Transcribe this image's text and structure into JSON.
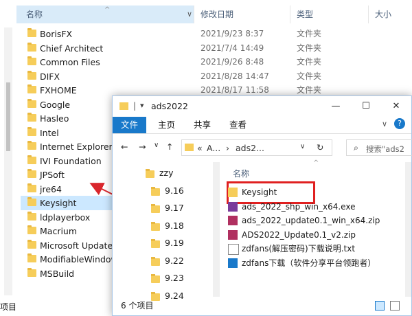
{
  "back": {
    "columns": {
      "name": "名称",
      "date": "修改日期",
      "type": "类型",
      "size": "大小"
    },
    "rows": [
      {
        "name": "BorisFX",
        "date": "2021/9/23 8:37",
        "type": "文件夹"
      },
      {
        "name": "Chief Architect",
        "date": "2021/7/4 14:49",
        "type": "文件夹"
      },
      {
        "name": "Common Files",
        "date": "2021/9/26 8:48",
        "type": "文件夹"
      },
      {
        "name": "DIFX",
        "date": "2021/8/28 14:47",
        "type": "文件夹"
      },
      {
        "name": "FXHOME",
        "date": "2021/8/17 11:58",
        "type": "文件夹"
      },
      {
        "name": "Google",
        "date": "",
        "type": ""
      },
      {
        "name": "Hasleo",
        "date": "",
        "type": ""
      },
      {
        "name": "Intel",
        "date": "",
        "type": ""
      },
      {
        "name": "Internet Explorer",
        "date": "",
        "type": ""
      },
      {
        "name": "IVI Foundation",
        "date": "",
        "type": ""
      },
      {
        "name": "JPSoft",
        "date": "",
        "type": ""
      },
      {
        "name": "jre64",
        "date": "",
        "type": ""
      },
      {
        "name": "Keysight",
        "date": "",
        "type": ""
      },
      {
        "name": "ldplayerbox",
        "date": "",
        "type": ""
      },
      {
        "name": "Macrium",
        "date": "",
        "type": ""
      },
      {
        "name": "Microsoft Update",
        "date": "",
        "type": ""
      },
      {
        "name": "ModifiableWindow",
        "date": "",
        "type": ""
      },
      {
        "name": "MSBuild",
        "date": "",
        "type": ""
      }
    ],
    "status": "项目"
  },
  "front": {
    "title": "ads2022",
    "tabs": {
      "file": "文件",
      "home": "主页",
      "share": "共享",
      "view": "查看"
    },
    "address": {
      "a": "A...",
      "b": "ads2..."
    },
    "search_placeholder": "搜索\"ads2",
    "tree": [
      "zzy",
      "9.16",
      "9.17",
      "9.18",
      "9.19",
      "9.22",
      "9.23",
      "9.24"
    ],
    "col_name": "名称",
    "files": [
      "Keysight",
      "ads_2022_shp_win_x64.exe",
      "ads_2022_update0.1_win_x64.zip",
      "ADS2022_Update0.1_v2.zip",
      "zdfans(解压密码)下载说明.txt",
      "zdfans下载（软件分享平台领跑者）"
    ],
    "status": "6 个项目"
  },
  "colors": {
    "accent": "#1979ca",
    "folder": "#f6cd5a",
    "highlight": "#e02020",
    "selection": "#cce8ff"
  }
}
